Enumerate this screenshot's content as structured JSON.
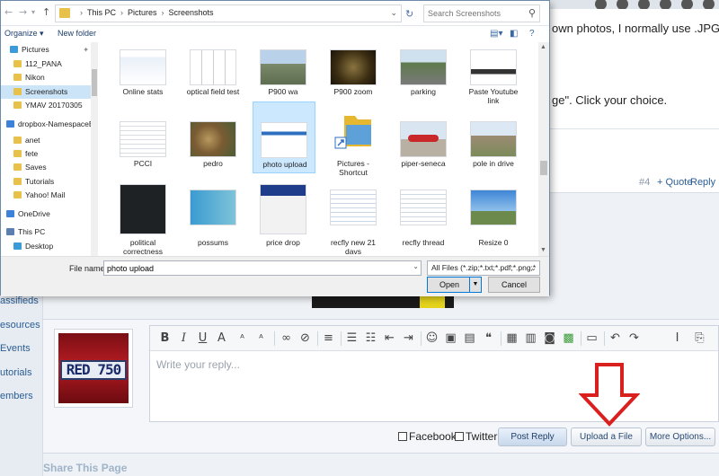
{
  "forum": {
    "post_line1": "own photos, I normally use .JPG",
    "post_line2": "ge\". Click your choice.",
    "post_number": "#4",
    "quote_label": "+ Quote",
    "reply_label": "Reply",
    "nav": [
      "assifieds",
      "esources",
      "Events",
      "utorials",
      "embers"
    ],
    "avatar_plate": "RED 750",
    "editor_placeholder": "Write your reply...",
    "facebook_label": "Facebook?",
    "twitter_label": "Twitter",
    "post_reply_button": "Post Reply",
    "upload_button": "Upload a File",
    "more_options_button": "More Options...",
    "share_title": "Share This Page",
    "arrow_color": "#d9201f"
  },
  "dialog": {
    "breadcrumbs": [
      "This PC",
      "Pictures",
      "Screenshots"
    ],
    "search_placeholder": "Search Screenshots",
    "organize_label": "Organize ▾",
    "new_folder_label": "New folder",
    "nav_items": [
      {
        "label": "Pictures",
        "icon": "pictures-icon",
        "pinned": true
      },
      {
        "label": "112_PANA",
        "icon": "folder-icon"
      },
      {
        "label": "Nikon",
        "icon": "folder-icon"
      },
      {
        "label": "Screenshots",
        "icon": "folder-icon",
        "selected": true
      },
      {
        "label": "YMAV 20170305",
        "icon": "folder-icon"
      },
      {
        "label": "dropbox-NamespaceEx",
        "icon": "dropbox-icon"
      },
      {
        "label": "anet",
        "icon": "folder-icon"
      },
      {
        "label": "fete",
        "icon": "folder-icon"
      },
      {
        "label": "Saves",
        "icon": "folder-icon"
      },
      {
        "label": "Tutorials",
        "icon": "folder-icon"
      },
      {
        "label": "Yahoo! Mail",
        "icon": "folder-icon"
      },
      {
        "label": "OneDrive",
        "icon": "onedrive-icon"
      },
      {
        "label": "This PC",
        "icon": "computer-icon"
      },
      {
        "label": "Desktop",
        "icon": "desktop-icon"
      }
    ],
    "files": [
      "Online stats",
      "optical field test",
      "P900 wa",
      "P900 zoom",
      "parking",
      "Paste Youtube link",
      "PCCI",
      "pedro",
      "photo upload",
      "Pictures - Shortcut",
      "piper-seneca",
      "pole in drive",
      "political correctness",
      "possums",
      "price drop",
      "recfly new 21 davs",
      "recfly thread",
      "Resize 0"
    ],
    "selected_file": "photo upload",
    "file_name_label": "File name:",
    "file_name_value": "photo upload",
    "file_type": "All Files (*.zip;*.txt;*.pdf;*.png;*",
    "open_button": "Open",
    "cancel_button": "Cancel"
  }
}
